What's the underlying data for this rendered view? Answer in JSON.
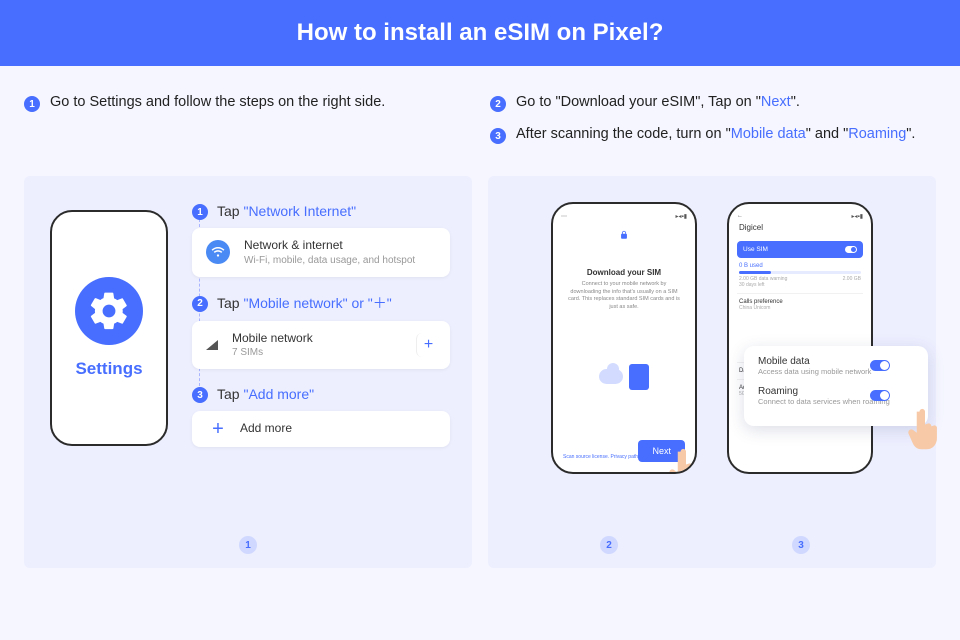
{
  "header": {
    "title": "How to install an eSIM on Pixel?"
  },
  "intro": {
    "step1": "Go to Settings and follow the steps on the right side.",
    "step2_a": "Go to \"Download your eSIM\", Tap on \"",
    "step2_b": "Next",
    "step2_c": "\".",
    "step3_a": "After scanning the code, turn on \"",
    "step3_b": "Mobile data",
    "step3_c": "\" and \"",
    "step3_d": "Roaming",
    "step3_e": "\"."
  },
  "left_card": {
    "settings_label": "Settings",
    "s1_prefix": "Tap ",
    "s1_link": "\"Network Internet\"",
    "row1_title": "Network & internet",
    "row1_sub": "Wi-Fi, mobile, data usage, and hotspot",
    "s2_prefix": "Tap ",
    "s2_link_a": "\"Mobile network\"",
    "s2_mid": " or ",
    "s2_link_b": "\"＋\"",
    "row2_title": "Mobile network",
    "row2_sub": "7 SIMs",
    "plus": "+",
    "s3_prefix": "Tap ",
    "s3_link": "\"Add more\"",
    "row3_title": "Add more",
    "badge": "1"
  },
  "right_card": {
    "download_title": "Download your SIM",
    "download_sub": "Connect to your mobile network by downloading the info that's usually on a SIM card. This replaces standard SIM cards and is just as safe.",
    "next": "Next",
    "tiny_link": "Scan source license. Privacy path",
    "carrier": "Digicel",
    "use_sim": "Use SIM",
    "usage_label": "0 B used",
    "usage_warn": "2.00 GB data warning",
    "usage_days": "30 days left",
    "usage_total": "2.00 GB",
    "calls_pref": "Calls preference",
    "calls_sub": "China Unicom",
    "data_warn_title": "Data warning & limit",
    "advanced_title": "Advanced",
    "advanced_sub": "5G 2IM, Preferred network tips, Settings version, Ca...",
    "overlay_mobile_t": "Mobile data",
    "overlay_mobile_s": "Access data using mobile network",
    "overlay_roam_t": "Roaming",
    "overlay_roam_s": "Connect to data services when roaming",
    "badge2": "2",
    "badge3": "3"
  }
}
